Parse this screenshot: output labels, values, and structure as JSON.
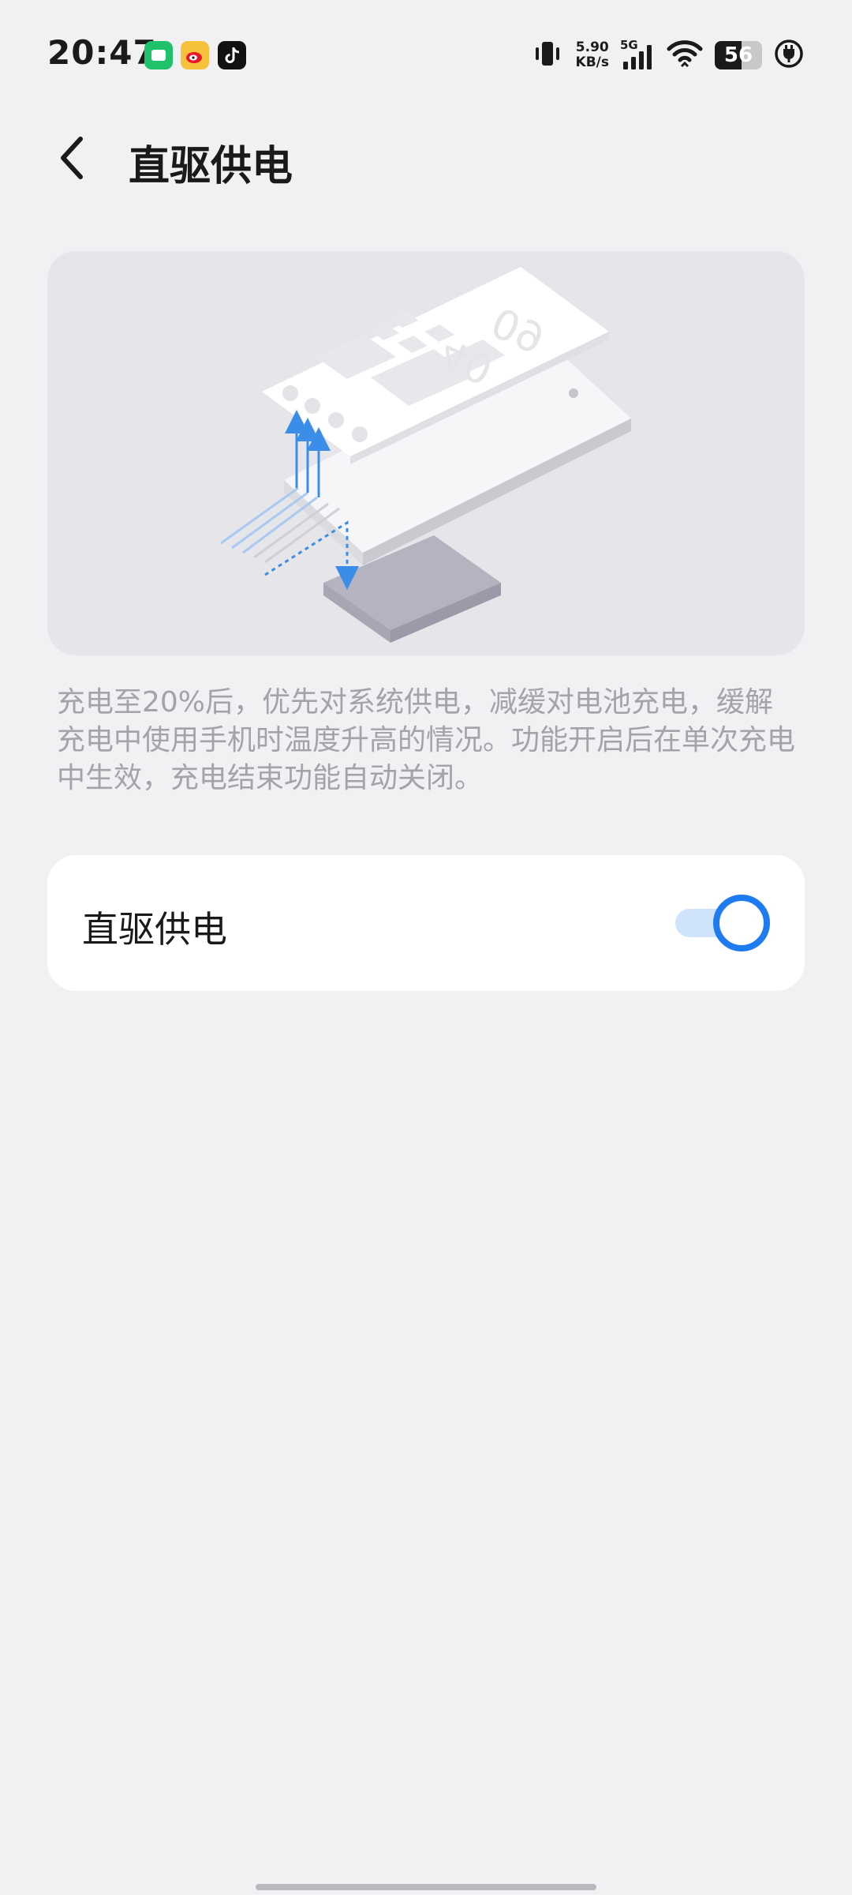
{
  "status_bar": {
    "time": "20:47",
    "net_speed_value": "5.90",
    "net_speed_unit": "KB/s",
    "network_type": "5G",
    "battery_level": "56",
    "battery_fraction": 0.56,
    "notification_icons": [
      "chat-app-icon",
      "weibo-icon",
      "tiktok-icon"
    ]
  },
  "header": {
    "title": "直驱供电"
  },
  "illustration": {
    "clock_hours": "09",
    "clock_minutes": "40"
  },
  "description": "充电至20%后，优先对系统供电，减缓对电池充电，缓解充电中使用手机时温度升高的情况。功能开启后在单次充电中生效，充电结束功能自动关闭。",
  "setting": {
    "label": "直驱供电",
    "enabled": true
  },
  "colors": {
    "accent": "#1f7cf0",
    "background": "#f1f1f3",
    "card": "#ffffff"
  }
}
